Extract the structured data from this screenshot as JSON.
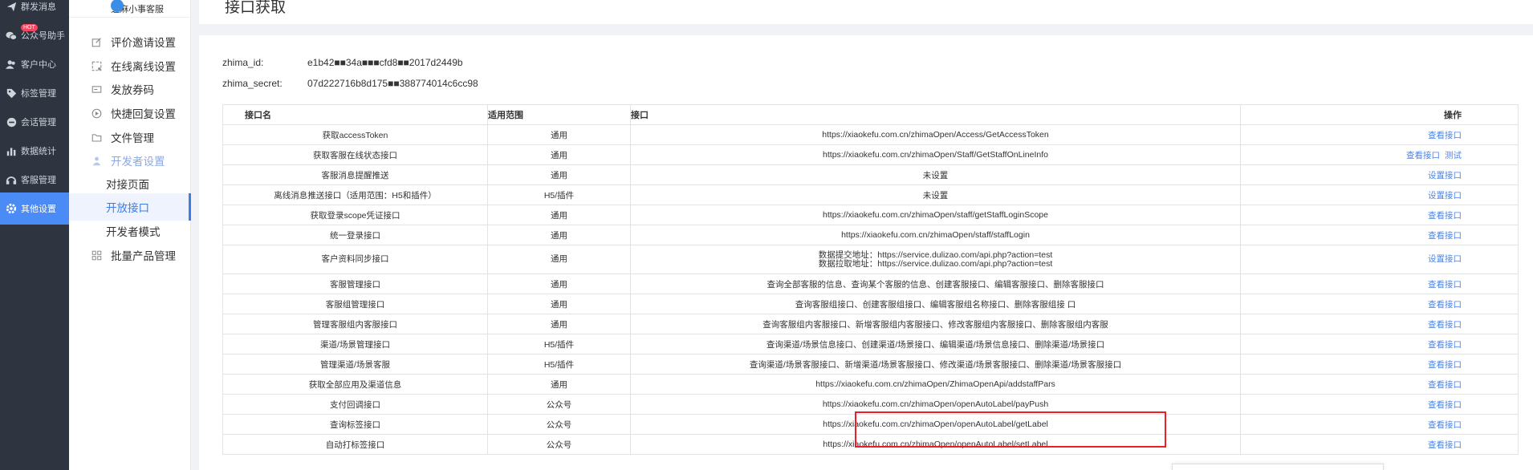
{
  "nav": {
    "items": [
      {
        "label": "群发消息",
        "icon": "send-icon"
      },
      {
        "label": "公众号助手",
        "icon": "wechat-icon",
        "badge": "HOT"
      },
      {
        "label": "客户中心",
        "icon": "users-icon"
      },
      {
        "label": "标签管理",
        "icon": "tag-icon"
      },
      {
        "label": "会话管理",
        "icon": "chat-icon"
      },
      {
        "label": "数据统计",
        "icon": "bar-chart-icon"
      },
      {
        "label": "客服管理",
        "icon": "headset-icon"
      },
      {
        "label": "其他设置",
        "icon": "settings-icon"
      }
    ],
    "active_index": 7
  },
  "sub": {
    "brand": "芝麻小事客服",
    "items": [
      {
        "label": "评价邀请设置",
        "icon": "edit-icon"
      },
      {
        "label": "在线离线设置",
        "icon": "status-icon"
      },
      {
        "label": "发放券码",
        "icon": "coupon-icon"
      },
      {
        "label": "快捷回复设置",
        "icon": "reply-icon"
      },
      {
        "label": "文件管理",
        "icon": "folder-icon"
      },
      {
        "label": "开发者设置",
        "icon": "developer-icon"
      },
      {
        "label": "对接页面"
      },
      {
        "label": "开放接口"
      },
      {
        "label": "开发者模式"
      },
      {
        "label": "批量产品管理",
        "icon": "grid-icon"
      }
    ]
  },
  "page": {
    "title": "接口获取"
  },
  "credentials": {
    "id_label": "zhima_id:",
    "id_value": "e1b42■■34a■■■cfd8■■2017d2449b",
    "secret_label": "zhima_secret:",
    "secret_value": "07d222716b8d175■■388774014c6cc98"
  },
  "table": {
    "headers": [
      "接口名",
      "适用范围",
      "接口",
      "操作"
    ],
    "rows": [
      {
        "name": "获取accessToken",
        "scope": "通用",
        "api": "https://xiaokefu.com.cn/zhimaOpen/Access/GetAccessToken",
        "ops": [
          "查看接口"
        ]
      },
      {
        "name": "获取客服在线状态接口",
        "scope": "通用",
        "api": "https://xiaokefu.com.cn/zhimaOpen/Staff/GetStaffOnLineInfo",
        "ops": [
          "查看接口",
          "测试"
        ]
      },
      {
        "name": "客服消息提醒推送",
        "scope": "通用",
        "api": "未设置",
        "ops": [
          "设置接口"
        ]
      },
      {
        "name": "离线消息推送接口（适用范围：H5和插件）",
        "scope": "H5/插件",
        "api": "未设置",
        "ops": [
          "设置接口"
        ]
      },
      {
        "name": "获取登录scope凭证接口",
        "scope": "通用",
        "api": "https://xiaokefu.com.cn/zhimaOpen/staff/getStaffLoginScope",
        "ops": [
          "查看接口"
        ]
      },
      {
        "name": "统一登录接口",
        "scope": "通用",
        "api": "https://xiaokefu.com.cn/zhimaOpen/staff/staffLogin",
        "ops": [
          "查看接口"
        ]
      },
      {
        "name": "客户资料同步接口",
        "scope": "通用",
        "api": "数据提交地址：https://service.dulizao.com/api.php?action=test",
        "api2": "数据拉取地址：https://service.dulizao.com/api.php?action=test",
        "ops": [
          "设置接口"
        ]
      },
      {
        "name": "客服管理接口",
        "scope": "通用",
        "api": "查询全部客服的信息、查询某个客服的信息、创建客服接口、编辑客服接口、删除客服接口",
        "ops": [
          "查看接口"
        ]
      },
      {
        "name": "客服组管理接口",
        "scope": "通用",
        "api": "查询客服组接口、创建客服组接口、编辑客服组名称接口、删除客服组接 口",
        "ops": [
          "查看接口"
        ]
      },
      {
        "name": "管理客服组内客服接口",
        "scope": "通用",
        "api": "查询客服组内客服接口、新增客服组内客服接口、修改客服组内客服接口、删除客服组内客服",
        "ops": [
          "查看接口"
        ]
      },
      {
        "name": "渠道/场景管理接口",
        "scope": "H5/插件",
        "api": "查询渠道/场景信息接口、创建渠道/场景接口、编辑渠道/场景信息接口、删除渠道/场景接口",
        "ops": [
          "查看接口"
        ]
      },
      {
        "name": "管理渠道/场景客服",
        "scope": "H5/插件",
        "api": "查询渠道/场景客服接口、新增渠道/场景客服接口、修改渠道/场景客服接口、删除渠道/场景客服接口",
        "ops": [
          "查看接口"
        ]
      },
      {
        "name": "获取全部应用及渠道信息",
        "scope": "通用",
        "api": "https://xiaokefu.com.cn/zhimaOpen/ZhimaOpenApi/addstaffPars",
        "ops": [
          "查看接口"
        ]
      },
      {
        "name": "支付回调接口",
        "scope": "公众号",
        "api": "https://xiaokefu.com.cn/zhimaOpen/openAutoLabel/payPush",
        "ops": [
          "查看接口"
        ]
      },
      {
        "name": "查询标签接口",
        "scope": "公众号",
        "api": "https://xiaokefu.com.cn/zhimaOpen/openAutoLabel/getLabel",
        "ops": [
          "查看接口"
        ]
      },
      {
        "name": "自动打标签接口",
        "scope": "公众号",
        "api": "https://xiaokefu.com.cn/zhimaOpen/openAutoLabel/setLabel",
        "ops": [
          "查看接口"
        ]
      }
    ]
  },
  "colors": {
    "nav_bg": "#2e3440",
    "active": "#4a8bf5",
    "link": "#4a84e8",
    "highlight": "#e8202a"
  }
}
